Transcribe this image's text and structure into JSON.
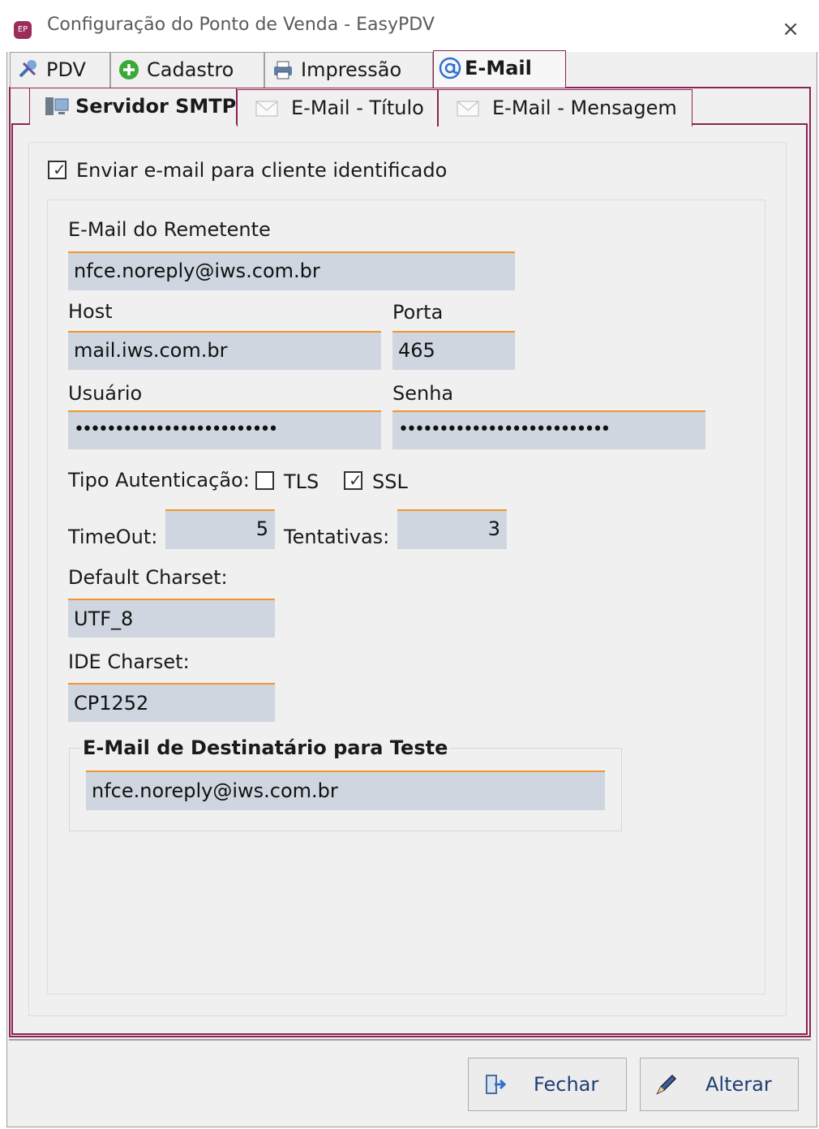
{
  "window": {
    "title": "Configuração do Ponto de Venda - EasyPDV",
    "app_icon": "EP",
    "close_icon": "×"
  },
  "outer_tabs": [
    {
      "label": "PDV",
      "icon": "tools-icon"
    },
    {
      "label": "Cadastro",
      "icon": "add-icon"
    },
    {
      "label": "Impressão",
      "icon": "printer-icon"
    },
    {
      "label": "E-Mail",
      "icon": "at-icon",
      "active": true
    }
  ],
  "inner_tabs": [
    {
      "label": "Servidor SMTP",
      "icon": "server-icon",
      "active": true
    },
    {
      "label": "E-Mail - Título",
      "icon": "envelope-icon"
    },
    {
      "label": "E-Mail - Mensagem",
      "icon": "envelope-icon"
    }
  ],
  "form": {
    "send_email_checkbox": {
      "label": "Enviar e-mail para cliente identificado",
      "checked": true
    },
    "sender_email": {
      "label": "E-Mail do Remetente",
      "value": "nfce.noreply@iws.com.br"
    },
    "host": {
      "label": "Host",
      "value": "mail.iws.com.br"
    },
    "port": {
      "label": "Porta",
      "value": "465"
    },
    "user": {
      "label": "Usuário",
      "value": "•••••••••••••••••••••••••"
    },
    "password": {
      "label": "Senha",
      "value": "••••••••••••••••••••••••••"
    },
    "auth_type": {
      "label": "Tipo Autenticação:",
      "tls": {
        "label": "TLS",
        "checked": false
      },
      "ssl": {
        "label": "SSL",
        "checked": true
      }
    },
    "timeout": {
      "label": "TimeOut:",
      "value": "5"
    },
    "attempts": {
      "label": "Tentativas:",
      "value": "3"
    },
    "default_charset": {
      "label": "Default Charset:",
      "value": "UTF_8"
    },
    "ide_charset": {
      "label": "IDE Charset:",
      "value": "CP1252"
    },
    "test_recipient": {
      "label": "E-Mail de Destinatário para Teste",
      "value": "nfce.noreply@iws.com.br"
    }
  },
  "buttons": {
    "close": "Fechar",
    "change": "Alterar"
  },
  "colors": {
    "accent": "#8c2252",
    "field_bg": "#cfd6e0",
    "field_border": "#f0962e",
    "button_text": "#1e3f73"
  }
}
